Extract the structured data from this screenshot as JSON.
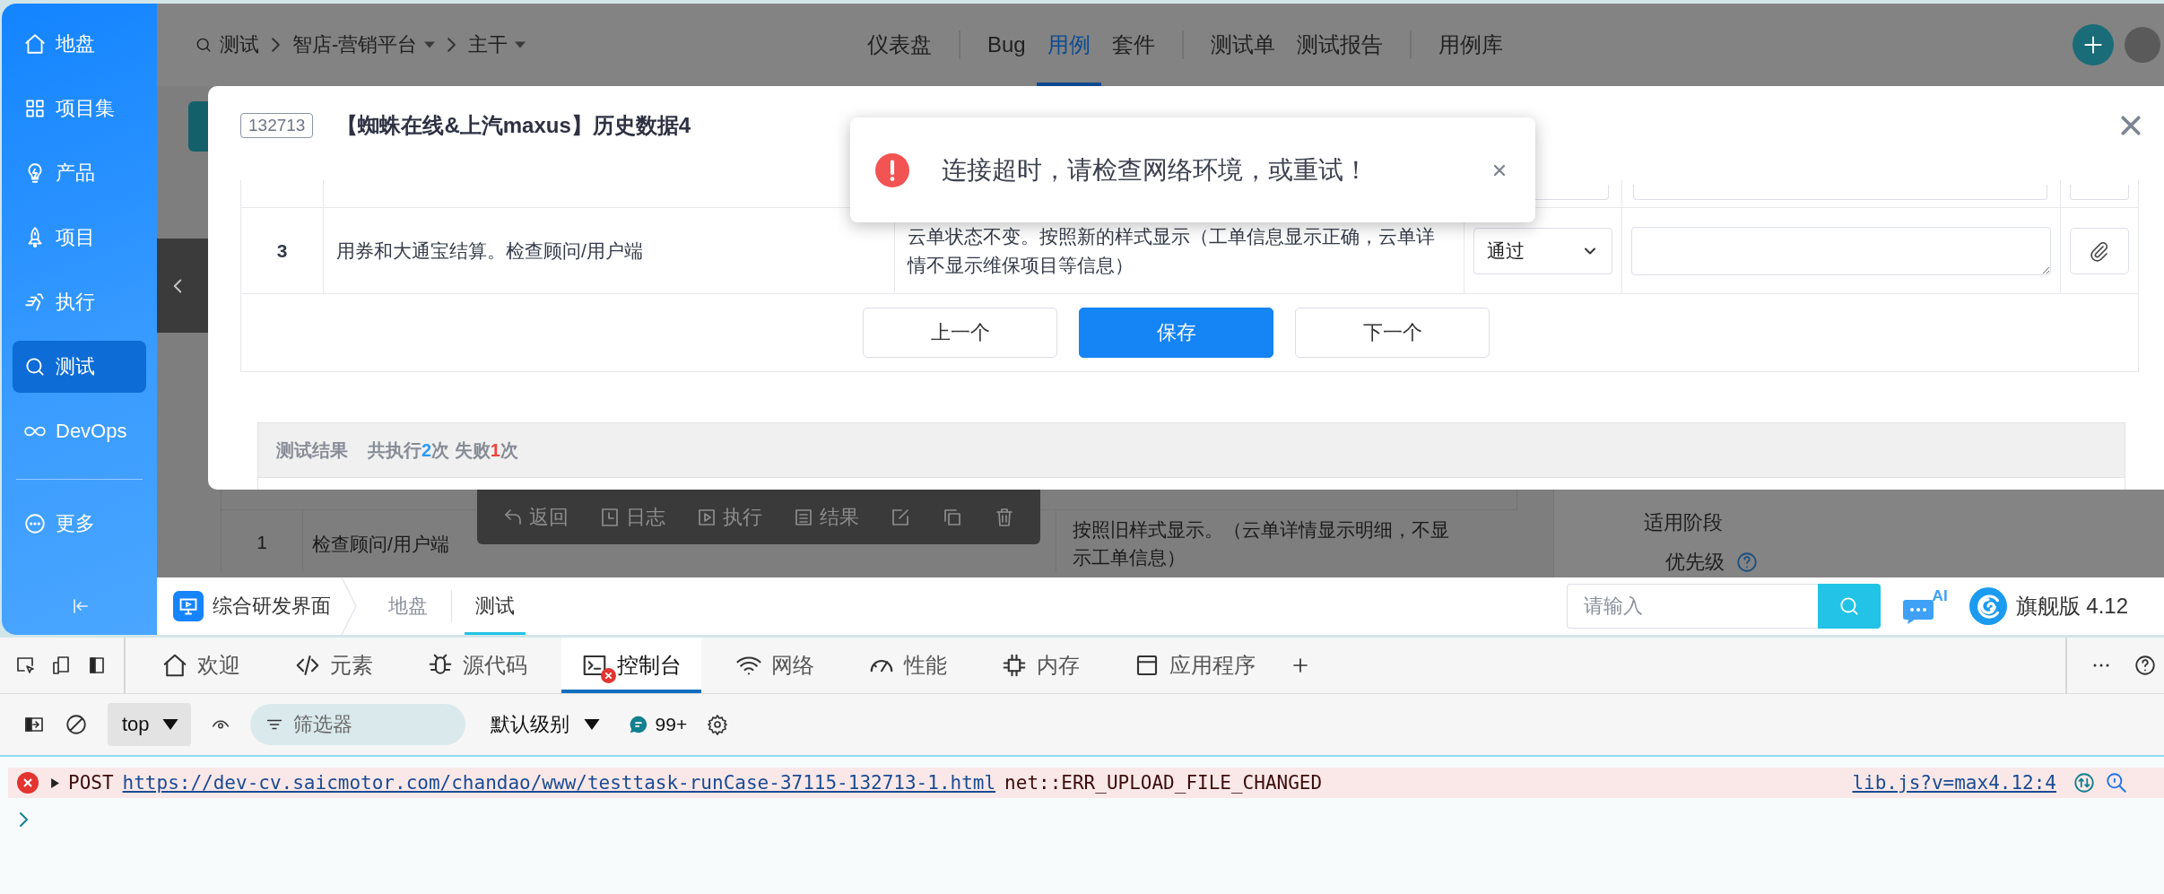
{
  "sidebar": {
    "items": [
      {
        "label": "地盘",
        "selected": false
      },
      {
        "label": "项目集",
        "selected": false
      },
      {
        "label": "产品",
        "selected": false
      },
      {
        "label": "项目",
        "selected": false
      },
      {
        "label": "执行",
        "selected": false
      },
      {
        "label": "测试",
        "selected": true
      },
      {
        "label": "DevOps",
        "selected": false
      }
    ],
    "more": {
      "label": "更多"
    }
  },
  "top_nav": {
    "breadcrumb": [
      {
        "label": "测试",
        "dropdown": false
      },
      {
        "label": "智店-营销平台",
        "dropdown": true
      },
      {
        "label": "主干",
        "dropdown": true
      }
    ],
    "groups": [
      {
        "items": [
          {
            "label": "仪表盘",
            "selected": false
          }
        ]
      },
      {
        "items": [
          {
            "label": "Bug",
            "selected": false
          },
          {
            "label": "用例",
            "selected": true
          },
          {
            "label": "套件",
            "selected": false
          }
        ]
      },
      {
        "items": [
          {
            "label": "测试单",
            "selected": false
          },
          {
            "label": "测试报告",
            "selected": false
          }
        ]
      },
      {
        "items": [
          {
            "label": "用例库",
            "selected": false
          }
        ]
      }
    ]
  },
  "background_page": {
    "rows": [
      {
        "number": "1",
        "step": "检查顾问/用户端",
        "expected": "按照旧样式显示。（云单详情显示明细，不显示工单信息）"
      }
    ],
    "toolbar": [
      {
        "label": "返回",
        "kind": "text"
      },
      {
        "label": "日志",
        "kind": "text"
      },
      {
        "label": "执行",
        "kind": "text"
      },
      {
        "label": "结果",
        "kind": "text"
      },
      {
        "kind": "icon"
      },
      {
        "kind": "icon"
      },
      {
        "kind": "icon"
      }
    ],
    "side_fields": [
      {
        "label": "适用阶段",
        "help": false
      },
      {
        "label": "优先级",
        "help": true
      }
    ]
  },
  "modal": {
    "case_id": "132713",
    "title": "【蜘蛛在线&上汽maxus】历史数据4",
    "steps": [
      {
        "number": "3",
        "step": "用券和大通宝结算。检查顾问/用户端",
        "expected": "云单状态不变。按照新的样式显示（工单信息显示正确，云单详情不显示维保项目等信息）",
        "result": "通过"
      }
    ],
    "buttons": [
      {
        "label": "上一个",
        "primary": false
      },
      {
        "label": "保存",
        "primary": true
      },
      {
        "label": "下一个",
        "primary": false
      }
    ],
    "result_summary": {
      "label": "测试结果",
      "parts": [
        {
          "text": "共执行",
          "kind": "text"
        },
        {
          "text": "2",
          "kind": "total"
        },
        {
          "text": "次 失败",
          "kind": "text"
        },
        {
          "text": "1",
          "kind": "failed"
        },
        {
          "text": "次",
          "kind": "text"
        }
      ]
    }
  },
  "toast": {
    "message": "连接超时，请检查网络环境，或重试！"
  },
  "bottom_bar": {
    "app_name": "综合研发界面",
    "breadcrumb": [
      {
        "label": "地盘",
        "selected": false
      },
      {
        "label": "测试",
        "selected": true
      }
    ],
    "search": {
      "placeholder": "请输入"
    },
    "ai_badge": "AI",
    "edition": "旗舰版 4.12"
  },
  "devtools": {
    "tabs": [
      {
        "label": "欢迎",
        "selected": false,
        "error": false
      },
      {
        "label": "元素",
        "selected": false,
        "error": false
      },
      {
        "label": "源代码",
        "selected": false,
        "error": false
      },
      {
        "label": "控制台",
        "selected": true,
        "error": true
      },
      {
        "label": "网络",
        "selected": false,
        "error": false
      },
      {
        "label": "性能",
        "selected": false,
        "error": false
      },
      {
        "label": "内存",
        "selected": false,
        "error": false
      },
      {
        "label": "应用程序",
        "selected": false,
        "error": false
      }
    ],
    "toolbar": {
      "context": "top",
      "filter": {
        "placeholder": "筛选器"
      },
      "level": "默认级别",
      "message_count": "99+"
    },
    "console": [
      {
        "method": "POST",
        "url": "https://dev-cv.saicmotor.com/chandao/www/testtask-runCase-37115-132713-1.html",
        "message": "net::ERR_UPLOAD_FILE_CHANGED",
        "source": "lib.js?v=max4.12:4"
      }
    ]
  }
}
